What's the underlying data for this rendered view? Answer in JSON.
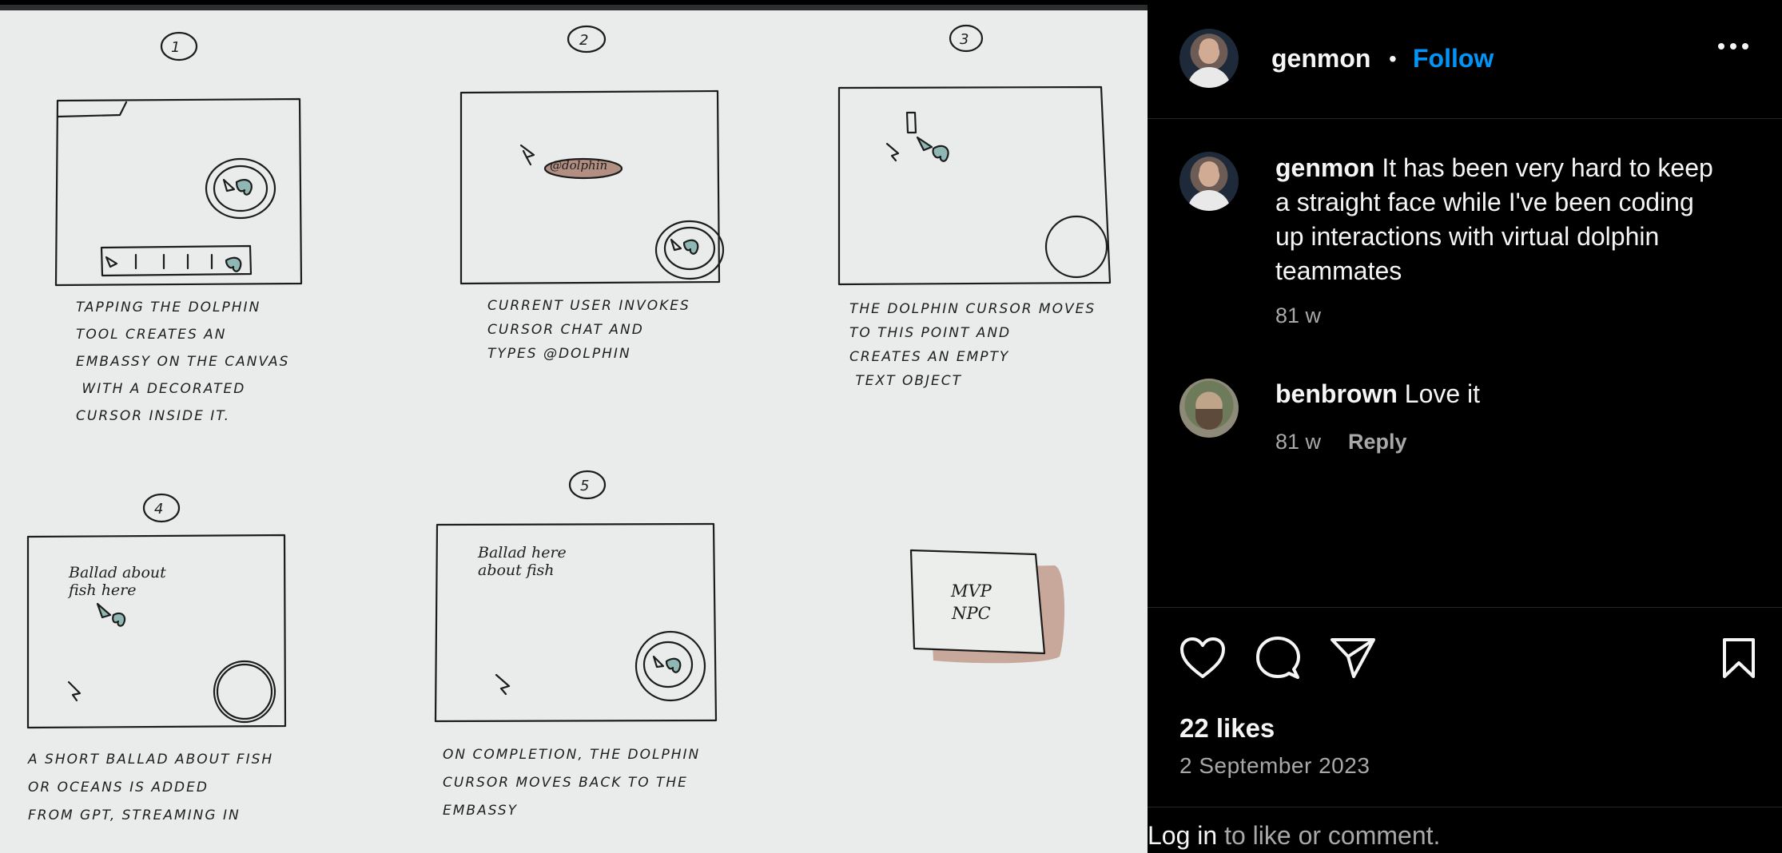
{
  "post": {
    "author": "genmon",
    "follow_label": "Follow",
    "separator": "•",
    "more_label": "More options"
  },
  "sketch": {
    "panels": [
      {
        "number": "1",
        "caption": "TAPPING THE DOLPHIN\nTOOL CREATES AN\nEMBASSY ON THE CANVAS\n WITH A DECORATED\nCURSOR INSIDE IT."
      },
      {
        "number": "2",
        "tag": "@dolphin",
        "caption": "CURRENT USER INVOKES\nCURSOR CHAT AND\nTYPES @DOLPHIN"
      },
      {
        "number": "3",
        "caption": "THE DOLPHIN CURSOR MOVES\nTO THIS POINT AND\nCREATES AN EMPTY\n TEXT OBJECT"
      },
      {
        "number": "4",
        "note": "Ballad about\nfish here",
        "caption": "A SHORT BALLAD ABOUT FISH\nOR OCEANS IS ADDED\nFROM GPT, STREAMING IN"
      },
      {
        "number": "5",
        "note": "Ballad here\nabout fish",
        "caption": "ON COMPLETION, THE DOLPHIN\nCURSOR MOVES BACK TO THE\nEMBASSY"
      }
    ],
    "sticky_note": "MVP\nNPC"
  },
  "comments": [
    {
      "user": "genmon",
      "text": "It has been very hard to keep a straight face while I've been coding up interactions with virtual dolphin teammates",
      "age": "81 w"
    },
    {
      "user": "benbrown",
      "text": "Love it",
      "age": "81 w",
      "reply_label": "Reply"
    }
  ],
  "actions": {
    "like_icon": "heart-icon",
    "comment_icon": "comment-icon",
    "share_icon": "paper-plane-icon",
    "save_icon": "bookmark-icon"
  },
  "likes": "22 likes",
  "date": "2 September 2023",
  "footer": {
    "login_label": "Log in",
    "rest": " to like or comment."
  },
  "colors": {
    "accent": "#0095f6",
    "background": "#000000",
    "muted": "#a8a8a8",
    "paper": "#e9ecea"
  }
}
